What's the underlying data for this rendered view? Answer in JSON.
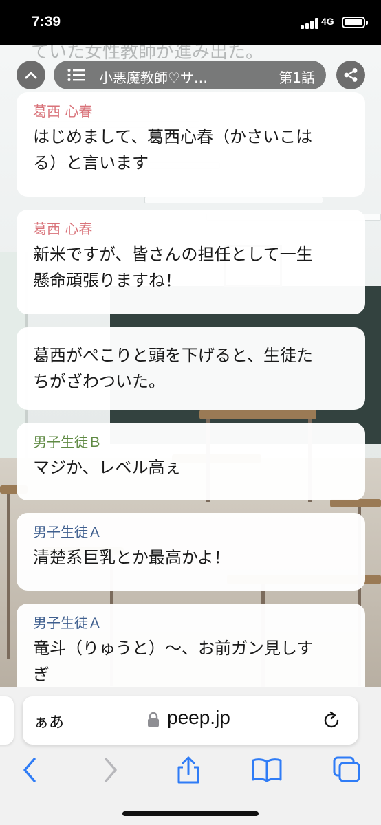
{
  "status_bar": {
    "time": "7:39",
    "network": "4G"
  },
  "background": {
    "partial_text": "ていた女性教師が進み出た。"
  },
  "nav": {
    "story_title": "小悪魔教師♡サ…",
    "episode": "第1話"
  },
  "messages": [
    {
      "speaker": "葛西 心春",
      "speaker_color": "#d9737a",
      "lines": [
        "はじめまして、葛西心春（かさいこは",
        "る）と言います"
      ]
    },
    {
      "speaker": "葛西 心春",
      "speaker_color": "#d9737a",
      "lines": [
        "新米ですが、皆さんの担任として一生",
        "懸命頑張りますね！"
      ]
    },
    {
      "speaker": "",
      "speaker_color": "",
      "lines": [
        "葛西がぺこりと頭を下げると、生徒た",
        "ちがざわついた。"
      ]
    },
    {
      "speaker": "男子生徒Ｂ",
      "speaker_color": "#5f8a43",
      "lines": [
        "マジか、レベル高ぇ"
      ]
    },
    {
      "speaker": "男子生徒Ａ",
      "speaker_color": "#3f5f8f",
      "lines": [
        "清楚系巨乳とか最高かよ！"
      ]
    },
    {
      "speaker": "男子生徒Ａ",
      "speaker_color": "#3f5f8f",
      "lines": [
        "竜斗（りゅうと）〜、お前ガン見しす",
        "ぎ"
      ]
    }
  ],
  "browser": {
    "text_size_button": "ぁあ",
    "url": "peep.jp",
    "accent_color": "#2f7cf6"
  },
  "icons": {
    "collapse": "chevron-up-icon",
    "menu": "list-icon",
    "share": "share-icon",
    "lock": "lock-icon",
    "reload": "reload-icon",
    "back": "back-chevron-icon",
    "forward": "forward-chevron-icon",
    "safari_share": "share-box-icon",
    "bookmarks": "book-icon",
    "tabs": "tabs-icon"
  }
}
